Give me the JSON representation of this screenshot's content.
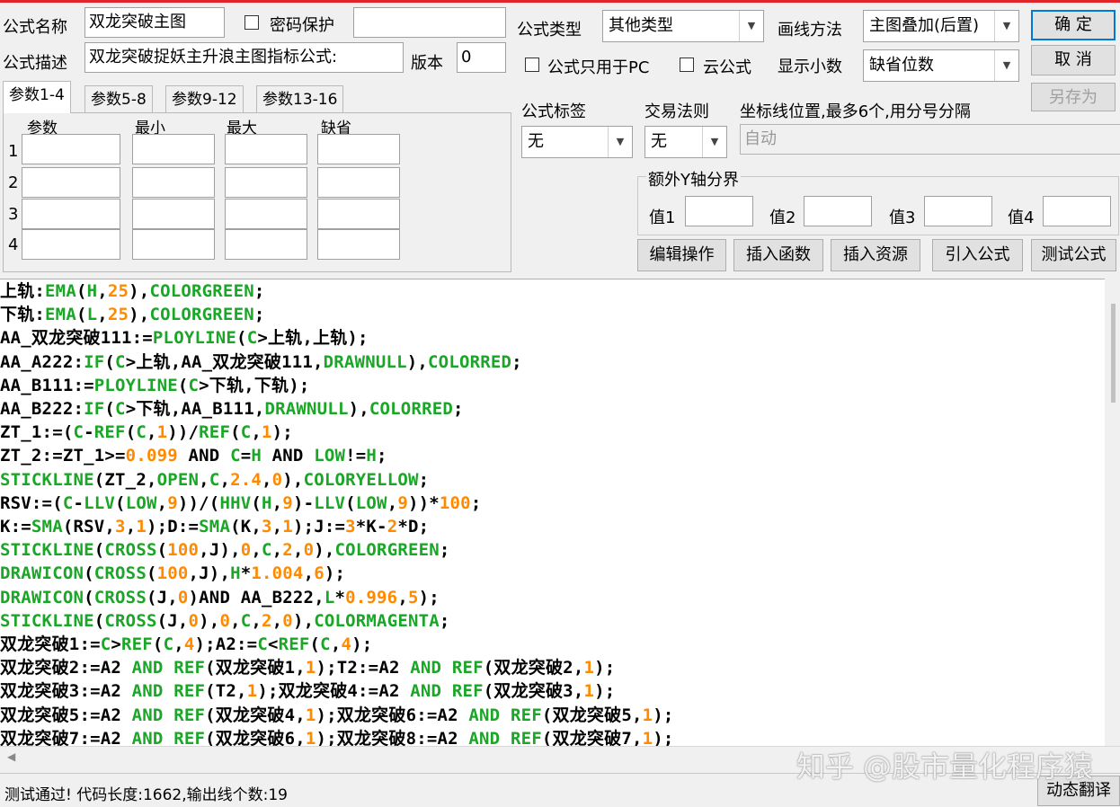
{
  "colors": {
    "green": "#1aa626",
    "orange": "#ff8a00",
    "black": "#000000",
    "accent_red": "#e0262a"
  },
  "form": {
    "name_label": "公式名称",
    "name_value": "双龙突破主图",
    "password_label": "密码保护",
    "desc_label": "公式描述",
    "desc_value": "双龙突破捉妖主升浪主图指标公式:",
    "version_label": "版本",
    "version_value": "0",
    "type_label": "公式类型",
    "type_value": "其他类型",
    "draw_label": "画线方法",
    "draw_value": "主图叠加(后置)",
    "pc_only_label": "公式只用于PC",
    "cloud_label": "云公式",
    "decimals_label": "显示小数",
    "decimals_value": "缺省位数",
    "tag_label": "公式标签",
    "tag_value": "无",
    "trade_label": "交易法则",
    "trade_value": "无",
    "axis_label": "坐标线位置,最多6个,用分号分隔",
    "axis_placeholder": "自动",
    "yaxis_group_label": "额外Y轴分界",
    "val1_label": "值1",
    "val2_label": "值2",
    "val3_label": "值3",
    "val4_label": "值4"
  },
  "buttons": {
    "ok": "确 定",
    "cancel": "取 消",
    "save_as": "另存为",
    "edit_ops": "编辑操作",
    "insert_func": "插入函数",
    "insert_res": "插入资源",
    "import_formula": "引入公式",
    "test_formula": "测试公式",
    "dyn_translate": "动态翻译"
  },
  "param_tabs": [
    "参数1-4",
    "参数5-8",
    "参数9-12",
    "参数13-16"
  ],
  "param_headers": [
    "参数",
    "最小",
    "最大",
    "缺省"
  ],
  "param_rows": [
    "1",
    "2",
    "3",
    "4"
  ],
  "code_lines": [
    [
      [
        "上轨:",
        "k"
      ],
      [
        "EMA",
        "g"
      ],
      [
        "(",
        "k"
      ],
      [
        "H",
        "g"
      ],
      [
        ",",
        "k"
      ],
      [
        "25",
        "o"
      ],
      [
        "),",
        "k"
      ],
      [
        "COLORGREEN",
        "g"
      ],
      [
        ";",
        "k"
      ]
    ],
    [
      [
        "下轨:",
        "k"
      ],
      [
        "EMA",
        "g"
      ],
      [
        "(",
        "k"
      ],
      [
        "L",
        "g"
      ],
      [
        ",",
        "k"
      ],
      [
        "25",
        "o"
      ],
      [
        "),",
        "k"
      ],
      [
        "COLORGREEN",
        "g"
      ],
      [
        ";",
        "k"
      ]
    ],
    [
      [
        "AA_双龙突破111:=",
        "k"
      ],
      [
        "PLOYLINE",
        "g"
      ],
      [
        "(",
        "k"
      ],
      [
        "C",
        "g"
      ],
      [
        ">上轨,上轨);",
        "k"
      ]
    ],
    [
      [
        "AA_A222:",
        "k"
      ],
      [
        "IF",
        "g"
      ],
      [
        "(",
        "k"
      ],
      [
        "C",
        "g"
      ],
      [
        ">上轨,AA_双龙突破111,",
        "k"
      ],
      [
        "DRAWNULL",
        "g"
      ],
      [
        "),",
        "k"
      ],
      [
        "COLORRED",
        "g"
      ],
      [
        ";",
        "k"
      ]
    ],
    [
      [
        "AA_B111:=",
        "k"
      ],
      [
        "PLOYLINE",
        "g"
      ],
      [
        "(",
        "k"
      ],
      [
        "C",
        "g"
      ],
      [
        ">下轨,下轨);",
        "k"
      ]
    ],
    [
      [
        "AA_B222:",
        "k"
      ],
      [
        "IF",
        "g"
      ],
      [
        "(",
        "k"
      ],
      [
        "C",
        "g"
      ],
      [
        ">下轨,AA_B111,",
        "k"
      ],
      [
        "DRAWNULL",
        "g"
      ],
      [
        "),",
        "k"
      ],
      [
        "COLORRED",
        "g"
      ],
      [
        ";",
        "k"
      ]
    ],
    [
      [
        "ZT_1:=(",
        "k"
      ],
      [
        "C",
        "g"
      ],
      [
        "-",
        "k"
      ],
      [
        "REF",
        "g"
      ],
      [
        "(",
        "k"
      ],
      [
        "C",
        "g"
      ],
      [
        ",",
        "k"
      ],
      [
        "1",
        "o"
      ],
      [
        "))/",
        "k"
      ],
      [
        "REF",
        "g"
      ],
      [
        "(",
        "k"
      ],
      [
        "C",
        "g"
      ],
      [
        ",",
        "k"
      ],
      [
        "1",
        "o"
      ],
      [
        ");",
        "k"
      ]
    ],
    [
      [
        "ZT_2:=ZT_1>=",
        "k"
      ],
      [
        "0.099",
        "o"
      ],
      [
        " AND ",
        "k"
      ],
      [
        "C",
        "g"
      ],
      [
        "=",
        "k"
      ],
      [
        "H",
        "g"
      ],
      [
        " AND ",
        "k"
      ],
      [
        "LOW",
        "g"
      ],
      [
        "!=",
        "k"
      ],
      [
        "H",
        "g"
      ],
      [
        ";",
        "k"
      ]
    ],
    [
      [
        "STICKLINE",
        "g"
      ],
      [
        "(ZT_2,",
        "k"
      ],
      [
        "OPEN",
        "g"
      ],
      [
        ",",
        "k"
      ],
      [
        "C",
        "g"
      ],
      [
        ",",
        "k"
      ],
      [
        "2.4",
        "o"
      ],
      [
        ",",
        "k"
      ],
      [
        "0",
        "o"
      ],
      [
        "),",
        "k"
      ],
      [
        "COLORYELLOW",
        "g"
      ],
      [
        ";",
        "k"
      ]
    ],
    [
      [
        "RSV:=(",
        "k"
      ],
      [
        "C",
        "g"
      ],
      [
        "-",
        "k"
      ],
      [
        "LLV",
        "g"
      ],
      [
        "(",
        "k"
      ],
      [
        "LOW",
        "g"
      ],
      [
        ",",
        "k"
      ],
      [
        "9",
        "o"
      ],
      [
        "))/(",
        "k"
      ],
      [
        "HHV",
        "g"
      ],
      [
        "(",
        "k"
      ],
      [
        "H",
        "g"
      ],
      [
        ",",
        "k"
      ],
      [
        "9",
        "o"
      ],
      [
        ")-",
        "k"
      ],
      [
        "LLV",
        "g"
      ],
      [
        "(",
        "k"
      ],
      [
        "LOW",
        "g"
      ],
      [
        ",",
        "k"
      ],
      [
        "9",
        "o"
      ],
      [
        "))*",
        "k"
      ],
      [
        "100",
        "o"
      ],
      [
        ";",
        "k"
      ]
    ],
    [
      [
        "K:=",
        "k"
      ],
      [
        "SMA",
        "g"
      ],
      [
        "(RSV,",
        "k"
      ],
      [
        "3",
        "o"
      ],
      [
        ",",
        "k"
      ],
      [
        "1",
        "o"
      ],
      [
        ");D:=",
        "k"
      ],
      [
        "SMA",
        "g"
      ],
      [
        "(K,",
        "k"
      ],
      [
        "3",
        "o"
      ],
      [
        ",",
        "k"
      ],
      [
        "1",
        "o"
      ],
      [
        ");J:=",
        "k"
      ],
      [
        "3",
        "o"
      ],
      [
        "*K-",
        "k"
      ],
      [
        "2",
        "o"
      ],
      [
        "*D;",
        "k"
      ]
    ],
    [
      [
        "STICKLINE",
        "g"
      ],
      [
        "(",
        "k"
      ],
      [
        "CROSS",
        "g"
      ],
      [
        "(",
        "k"
      ],
      [
        "100",
        "o"
      ],
      [
        ",J),",
        "k"
      ],
      [
        "0",
        "o"
      ],
      [
        ",",
        "k"
      ],
      [
        "C",
        "g"
      ],
      [
        ",",
        "k"
      ],
      [
        "2",
        "o"
      ],
      [
        ",",
        "k"
      ],
      [
        "0",
        "o"
      ],
      [
        "),",
        "k"
      ],
      [
        "COLORGREEN",
        "g"
      ],
      [
        ";",
        "k"
      ]
    ],
    [
      [
        "DRAWICON",
        "g"
      ],
      [
        "(",
        "k"
      ],
      [
        "CROSS",
        "g"
      ],
      [
        "(",
        "k"
      ],
      [
        "100",
        "o"
      ],
      [
        ",J),",
        "k"
      ],
      [
        "H",
        "g"
      ],
      [
        "*",
        "k"
      ],
      [
        "1.004",
        "o"
      ],
      [
        ",",
        "k"
      ],
      [
        "6",
        "o"
      ],
      [
        ");",
        "k"
      ]
    ],
    [
      [
        "DRAWICON",
        "g"
      ],
      [
        "(",
        "k"
      ],
      [
        "CROSS",
        "g"
      ],
      [
        "(J,",
        "k"
      ],
      [
        "0",
        "o"
      ],
      [
        ")AND AA_B222,",
        "k"
      ],
      [
        "L",
        "g"
      ],
      [
        "*",
        "k"
      ],
      [
        "0.996",
        "o"
      ],
      [
        ",",
        "k"
      ],
      [
        "5",
        "o"
      ],
      [
        ");",
        "k"
      ]
    ],
    [
      [
        "STICKLINE",
        "g"
      ],
      [
        "(",
        "k"
      ],
      [
        "CROSS",
        "g"
      ],
      [
        "(J,",
        "k"
      ],
      [
        "0",
        "o"
      ],
      [
        "),",
        "k"
      ],
      [
        "0",
        "o"
      ],
      [
        ",",
        "k"
      ],
      [
        "C",
        "g"
      ],
      [
        ",",
        "k"
      ],
      [
        "2",
        "o"
      ],
      [
        ",",
        "k"
      ],
      [
        "0",
        "o"
      ],
      [
        "),",
        "k"
      ],
      [
        "COLORMAGENTA",
        "g"
      ],
      [
        ";",
        "k"
      ]
    ],
    [
      [
        "双龙突破1:=",
        "k"
      ],
      [
        "C",
        "g"
      ],
      [
        ">",
        "k"
      ],
      [
        "REF",
        "g"
      ],
      [
        "(",
        "k"
      ],
      [
        "C",
        "g"
      ],
      [
        ",",
        "k"
      ],
      [
        "4",
        "o"
      ],
      [
        ");A2:=",
        "k"
      ],
      [
        "C",
        "g"
      ],
      [
        "<",
        "k"
      ],
      [
        "REF",
        "g"
      ],
      [
        "(",
        "k"
      ],
      [
        "C",
        "g"
      ],
      [
        ",",
        "k"
      ],
      [
        "4",
        "o"
      ],
      [
        ");",
        "k"
      ]
    ],
    [
      [
        "双龙突破2:=A2 ",
        "k"
      ],
      [
        "AND",
        "g"
      ],
      [
        " ",
        "k"
      ],
      [
        "REF",
        "g"
      ],
      [
        "(双龙突破1,",
        "k"
      ],
      [
        "1",
        "o"
      ],
      [
        ");T2:=A2 ",
        "k"
      ],
      [
        "AND",
        "g"
      ],
      [
        " ",
        "k"
      ],
      [
        "REF",
        "g"
      ],
      [
        "(双龙突破2,",
        "k"
      ],
      [
        "1",
        "o"
      ],
      [
        ");",
        "k"
      ]
    ],
    [
      [
        "双龙突破3:=A2 ",
        "k"
      ],
      [
        "AND",
        "g"
      ],
      [
        " ",
        "k"
      ],
      [
        "REF",
        "g"
      ],
      [
        "(T2,",
        "k"
      ],
      [
        "1",
        "o"
      ],
      [
        ");双龙突破4:=A2 ",
        "k"
      ],
      [
        "AND",
        "g"
      ],
      [
        " ",
        "k"
      ],
      [
        "REF",
        "g"
      ],
      [
        "(双龙突破3,",
        "k"
      ],
      [
        "1",
        "o"
      ],
      [
        ");",
        "k"
      ]
    ],
    [
      [
        "双龙突破5:=A2 ",
        "k"
      ],
      [
        "AND",
        "g"
      ],
      [
        " ",
        "k"
      ],
      [
        "REF",
        "g"
      ],
      [
        "(双龙突破4,",
        "k"
      ],
      [
        "1",
        "o"
      ],
      [
        ");双龙突破6:=A2 ",
        "k"
      ],
      [
        "AND",
        "g"
      ],
      [
        " ",
        "k"
      ],
      [
        "REF",
        "g"
      ],
      [
        "(双龙突破5,",
        "k"
      ],
      [
        "1",
        "o"
      ],
      [
        ");",
        "k"
      ]
    ],
    [
      [
        "双龙突破7:=A2 ",
        "k"
      ],
      [
        "AND",
        "g"
      ],
      [
        " ",
        "k"
      ],
      [
        "REF",
        "g"
      ],
      [
        "(双龙突破6,",
        "k"
      ],
      [
        "1",
        "o"
      ],
      [
        ");双龙突破8:=A2 ",
        "k"
      ],
      [
        "AND",
        "g"
      ],
      [
        " ",
        "k"
      ],
      [
        "REF",
        "g"
      ],
      [
        "(双龙突破7,",
        "k"
      ],
      [
        "1",
        "o"
      ],
      [
        ");",
        "k"
      ]
    ]
  ],
  "status": {
    "message": "测试通过! 代码长度:1662,输出线个数:19"
  },
  "watermark": "知乎 @股市量化程序猿",
  "icons": {
    "dropdown": "chevron-down-icon",
    "scroll_left": "arrow-left-icon"
  }
}
